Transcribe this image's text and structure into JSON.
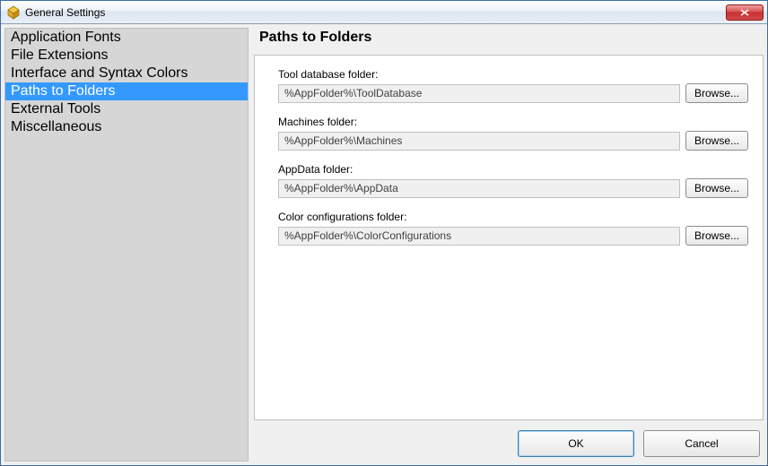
{
  "window": {
    "title": "General Settings"
  },
  "sidebar": {
    "items": [
      {
        "label": "Application Fonts",
        "selected": false
      },
      {
        "label": "File Extensions",
        "selected": false
      },
      {
        "label": "Interface and Syntax Colors",
        "selected": false
      },
      {
        "label": "Paths to Folders",
        "selected": true
      },
      {
        "label": "External Tools",
        "selected": false
      },
      {
        "label": "Miscellaneous",
        "selected": false
      }
    ]
  },
  "panel": {
    "title": "Paths to Folders",
    "fields": [
      {
        "label": "Tool database folder:",
        "value": "%AppFolder%\\ToolDatabase",
        "browse": "Browse..."
      },
      {
        "label": "Machines folder:",
        "value": "%AppFolder%\\Machines",
        "browse": "Browse..."
      },
      {
        "label": "AppData folder:",
        "value": "%AppFolder%\\AppData",
        "browse": "Browse..."
      },
      {
        "label": "Color configurations folder:",
        "value": "%AppFolder%\\ColorConfigurations",
        "browse": "Browse..."
      }
    ]
  },
  "buttons": {
    "ok": "OK",
    "cancel": "Cancel"
  }
}
